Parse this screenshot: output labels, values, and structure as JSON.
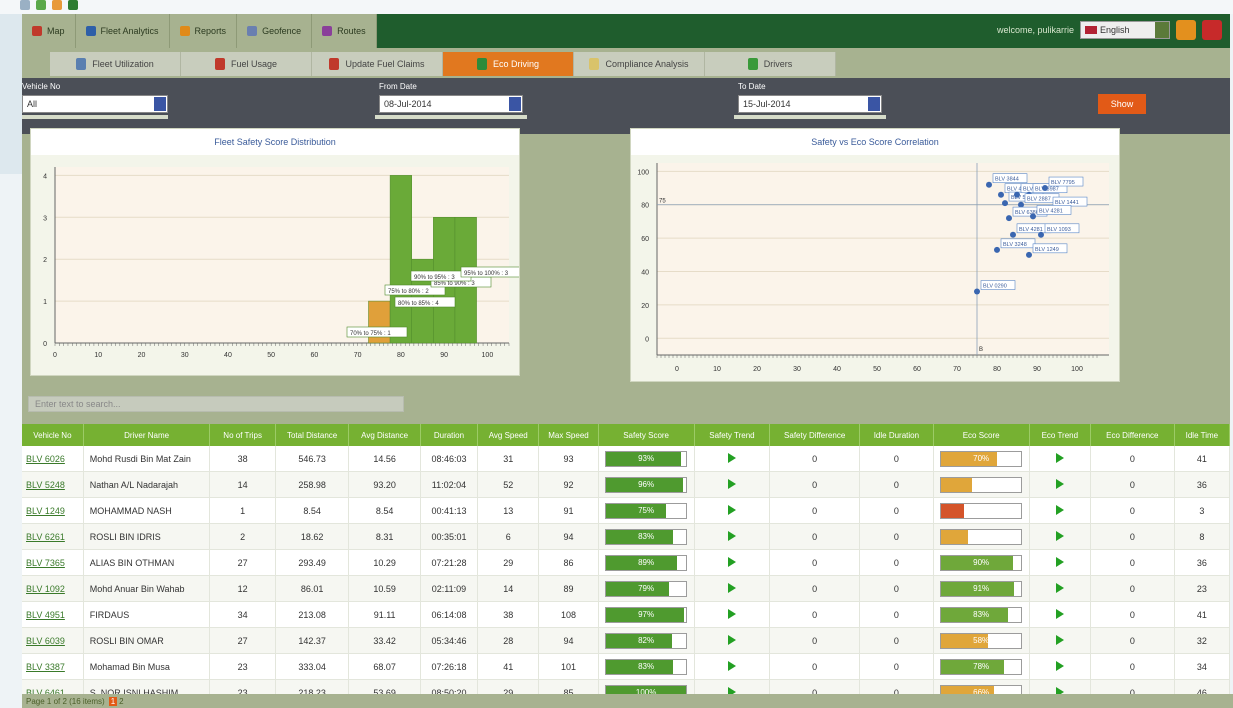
{
  "nav": {
    "menu": [
      {
        "label": "Map",
        "color": "#c0392b"
      },
      {
        "label": "Fleet Analytics",
        "color": "#2e5fa8"
      },
      {
        "label": "Reports",
        "color": "#e08a1a"
      },
      {
        "label": "Geofence",
        "color": "#6a7fb0"
      },
      {
        "label": "Routes",
        "color": "#8a3f9a"
      }
    ],
    "welcome": "welcome, pulikarrie",
    "language": "English"
  },
  "tabs": [
    {
      "label": "Fleet Utilization",
      "active": false
    },
    {
      "label": "Fuel Usage",
      "active": false
    },
    {
      "label": "Update Fuel Claims",
      "active": false
    },
    {
      "label": "Eco Driving",
      "active": true
    },
    {
      "label": "Compliance Analysis",
      "active": false
    },
    {
      "label": "Drivers",
      "active": false
    }
  ],
  "filters": {
    "vehicle_label": "Vehicle No",
    "vehicle_value": "All",
    "from_label": "From Date",
    "from_value": "08-Jul-2014",
    "to_label": "To Date",
    "to_value": "15-Jul-2014",
    "show_label": "Show"
  },
  "chart_data": [
    {
      "type": "bar",
      "title": "Fleet Safety Score Distribution",
      "x": [
        75,
        80,
        85,
        90,
        95
      ],
      "values": [
        1,
        4,
        2,
        3,
        3
      ],
      "xlim": [
        0,
        105
      ],
      "ylim": [
        0,
        4.2
      ],
      "xticks": [
        0,
        10,
        20,
        30,
        40,
        50,
        60,
        70,
        80,
        90,
        100
      ],
      "yticks": [
        0,
        1,
        2,
        3,
        4
      ],
      "annotations": [
        "70% to 75% : 1",
        "80% to 85% : 4",
        "75% to 80% : 2",
        "85% to 90% : 3",
        "90% to 95% : 3",
        "95% to 100% : 3"
      ],
      "grid": true
    },
    {
      "type": "scatter",
      "title": "Safety vs Eco Score Correlation",
      "points": [
        {
          "x": 78,
          "y": 92,
          "label": "BLV 3844"
        },
        {
          "x": 81,
          "y": 86,
          "label": "BLV 4951"
        },
        {
          "x": 82,
          "y": 81,
          "label": "BLV 5061"
        },
        {
          "x": 85,
          "y": 86,
          "label": "BLV 1061"
        },
        {
          "x": 88,
          "y": 86,
          "label": "BLV 3987"
        },
        {
          "x": 92,
          "y": 90,
          "label": "BLV 7795"
        },
        {
          "x": 86,
          "y": 80,
          "label": "BLV 2887"
        },
        {
          "x": 93,
          "y": 78,
          "label": "BLV 1441"
        },
        {
          "x": 83,
          "y": 72,
          "label": "BLV 6380"
        },
        {
          "x": 89,
          "y": 73,
          "label": "BLV 4281"
        },
        {
          "x": 84,
          "y": 62,
          "label": "BLV 4281"
        },
        {
          "x": 91,
          "y": 62,
          "label": "BLV 1093"
        },
        {
          "x": 80,
          "y": 53,
          "label": "BLV 3248"
        },
        {
          "x": 88,
          "y": 50,
          "label": "BLV 1249"
        },
        {
          "x": 75,
          "y": 28,
          "label": "BLV 0290"
        }
      ],
      "xlim": [
        -5,
        108
      ],
      "ylim": [
        -10,
        105
      ],
      "xticks": [
        0,
        10,
        20,
        30,
        40,
        50,
        60,
        70,
        80,
        90,
        100
      ],
      "yticks": [
        0,
        20,
        40,
        60,
        80,
        100
      ],
      "ref_x": 75,
      "ref_x_label": "B",
      "ref_y": 80,
      "ref_y_label": "75",
      "grid": true
    }
  ],
  "search_placeholder": "Enter text to search...",
  "table": {
    "headers": [
      "Vehicle No",
      "Driver Name",
      "No of Trips",
      "Total Distance",
      "Avg Distance",
      "Duration",
      "Avg Speed",
      "Max Speed",
      "Safety Score",
      "Safety Trend",
      "Safety Difference",
      "Idle Duration",
      "Eco Score",
      "Eco Trend",
      "Eco Difference",
      "Idle Time"
    ],
    "rows": [
      {
        "vehicle": "BLV 6026",
        "driver": "Mohd Rusdi Bin Mat Zain",
        "trips": "38",
        "total": "546.73",
        "avg": "14.56",
        "duration": "08:46:03",
        "avgspd": "31",
        "maxspd": "93",
        "safety": 0.93,
        "safety_txt": "93%",
        "sdiff": "0",
        "idle": "0",
        "eco": 0.7,
        "eco_txt": "70%",
        "eco_color": "#e0a63a",
        "ediff": "0",
        "idletime": "41"
      },
      {
        "vehicle": "BLV 5248",
        "driver": "Nathan A/L Nadarajah",
        "trips": "14",
        "total": "258.98",
        "avg": "93.20",
        "duration": "11:02:04",
        "avgspd": "52",
        "maxspd": "92",
        "safety": 0.96,
        "safety_txt": "96%",
        "sdiff": "0",
        "idle": "0",
        "eco": 0.38,
        "eco_txt": "38%",
        "eco_color": "#e0a63a",
        "ediff": "0",
        "idletime": "36"
      },
      {
        "vehicle": "BLV 1249",
        "driver": "MOHAMMAD NASH",
        "trips": "1",
        "total": "8.54",
        "avg": "8.54",
        "duration": "00:41:13",
        "avgspd": "13",
        "maxspd": "91",
        "safety": 0.75,
        "safety_txt": "75%",
        "sdiff": "0",
        "idle": "0",
        "eco": 0.28,
        "eco_txt": "28%",
        "eco_color": "#d4542a",
        "ediff": "0",
        "idletime": "3"
      },
      {
        "vehicle": "BLV 6261",
        "driver": "ROSLI BIN IDRIS",
        "trips": "2",
        "total": "18.62",
        "avg": "8.31",
        "duration": "00:35:01",
        "avgspd": "6",
        "maxspd": "94",
        "safety": 0.83,
        "safety_txt": "83%",
        "sdiff": "0",
        "idle": "0",
        "eco": 0.33,
        "eco_txt": "33%",
        "eco_color": "#e0a63a",
        "ediff": "0",
        "idletime": "8"
      },
      {
        "vehicle": "BLV 7365",
        "driver": "ALIAS BIN OTHMAN",
        "trips": "27",
        "total": "293.49",
        "avg": "10.29",
        "duration": "07:21:28",
        "avgspd": "29",
        "maxspd": "86",
        "safety": 0.89,
        "safety_txt": "89%",
        "sdiff": "0",
        "idle": "0",
        "eco": 0.9,
        "eco_txt": "90%",
        "eco_color": "#6fa83a",
        "ediff": "0",
        "idletime": "36"
      },
      {
        "vehicle": "BLV 1092",
        "driver": "Mohd Anuar Bin Wahab",
        "trips": "12",
        "total": "86.01",
        "avg": "10.59",
        "duration": "02:11:09",
        "avgspd": "14",
        "maxspd": "89",
        "safety": 0.79,
        "safety_txt": "79%",
        "sdiff": "0",
        "idle": "0",
        "eco": 0.91,
        "eco_txt": "91%",
        "eco_color": "#6fa83a",
        "ediff": "0",
        "idletime": "23"
      },
      {
        "vehicle": "BLV 4951",
        "driver": "FIRDAUS",
        "trips": "34",
        "total": "213.08",
        "avg": "91.11",
        "duration": "06:14:08",
        "avgspd": "38",
        "maxspd": "108",
        "safety": 0.97,
        "safety_txt": "97%",
        "sdiff": "0",
        "idle": "0",
        "eco": 0.83,
        "eco_txt": "83%",
        "eco_color": "#6fa83a",
        "ediff": "0",
        "idletime": "41"
      },
      {
        "vehicle": "BLV 6039",
        "driver": "ROSLI BIN OMAR",
        "trips": "27",
        "total": "142.37",
        "avg": "33.42",
        "duration": "05:34:46",
        "avgspd": "28",
        "maxspd": "94",
        "safety": 0.82,
        "safety_txt": "82%",
        "sdiff": "0",
        "idle": "0",
        "eco": 0.58,
        "eco_txt": "58%",
        "eco_color": "#e0a63a",
        "ediff": "0",
        "idletime": "32"
      },
      {
        "vehicle": "BLV 3387",
        "driver": "Mohamad Bin Musa",
        "trips": "23",
        "total": "333.04",
        "avg": "68.07",
        "duration": "07:26:18",
        "avgspd": "41",
        "maxspd": "101",
        "safety": 0.83,
        "safety_txt": "83%",
        "sdiff": "0",
        "idle": "0",
        "eco": 0.78,
        "eco_txt": "78%",
        "eco_color": "#6fa83a",
        "ediff": "0",
        "idletime": "34"
      },
      {
        "vehicle": "BLV 6461",
        "driver": "S. NOR ISNI HASHIM",
        "trips": "23",
        "total": "218.23",
        "avg": "53.69",
        "duration": "08:50:20",
        "avgspd": "29",
        "maxspd": "85",
        "safety": 1.0,
        "safety_txt": "100%",
        "sdiff": "0",
        "idle": "0",
        "eco": 0.66,
        "eco_txt": "66%",
        "eco_color": "#e0a63a",
        "ediff": "0",
        "idletime": "46"
      }
    ]
  },
  "pager": {
    "text": "Page 1 of 2 (16 items)",
    "pages": [
      "1",
      "2"
    ],
    "current": "1"
  }
}
